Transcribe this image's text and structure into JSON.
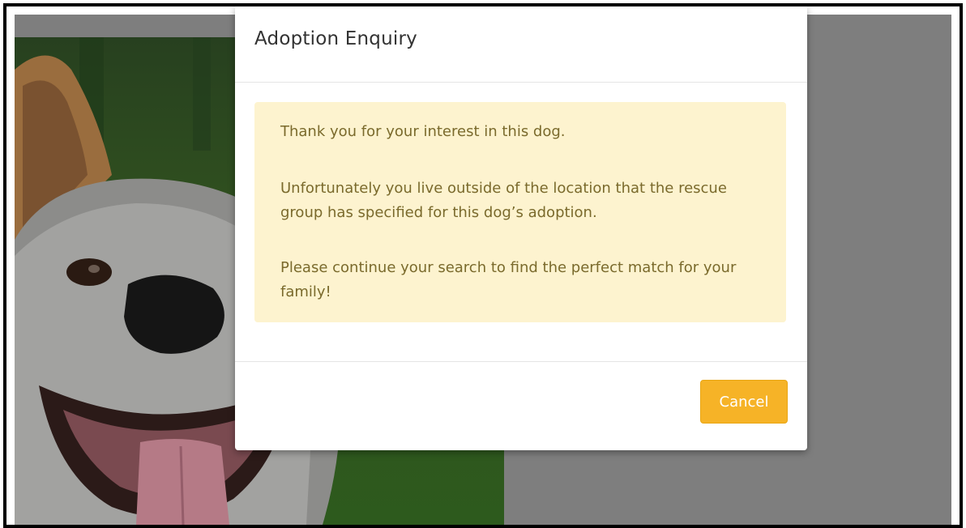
{
  "modal": {
    "title": "Adoption Enquiry",
    "message": {
      "line1": "Thank you for your interest in this dog.",
      "line2": "Unfortunately you live outside of the location that the rescue group has specified for this dog’s adoption.",
      "line3": "Please continue your search to find the perfect match for your family!"
    },
    "cancel_label": "Cancel"
  },
  "colors": {
    "accent": "#f6b327",
    "alert_background": "#fdf3cf",
    "alert_text": "#7a6a2c",
    "backdrop": "#7e7e7e"
  },
  "background_image": "dog-photo"
}
